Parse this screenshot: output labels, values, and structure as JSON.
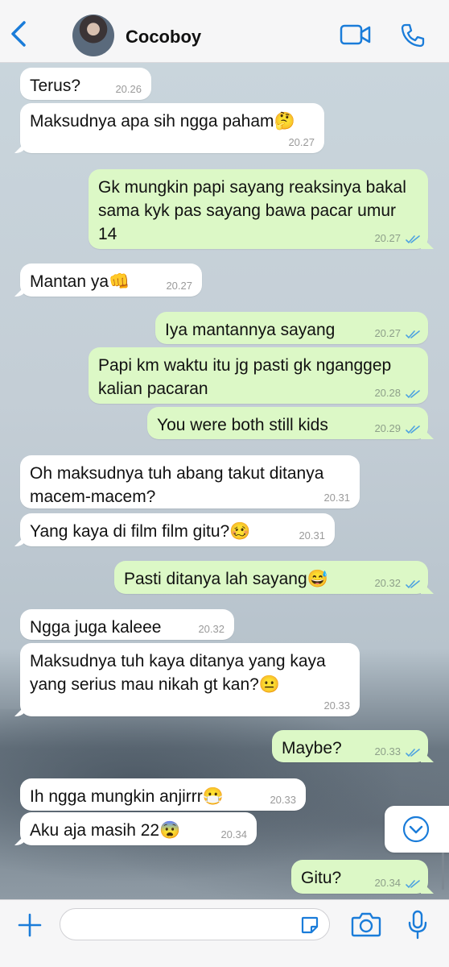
{
  "header": {
    "contact_name": "Cocoboy"
  },
  "messages": [
    {
      "dir": "in",
      "text": "Terus?",
      "time": "20.26"
    },
    {
      "dir": "in",
      "text": "Maksudnya apa sih ngga paham🤔",
      "time": "20.27"
    },
    {
      "dir": "out",
      "text": "Gk mungkin papi sayang reaksinya bakal sama kyk pas sayang bawa pacar umur 14",
      "time": "20.27"
    },
    {
      "dir": "in",
      "text": "Mantan ya👊",
      "time": "20.27"
    },
    {
      "dir": "out",
      "text": "Iya mantannya sayang",
      "time": "20.27"
    },
    {
      "dir": "out",
      "text": "Papi km waktu itu jg pasti gk nganggep kalian pacaran",
      "time": "20.28"
    },
    {
      "dir": "out",
      "text": "You were both still kids",
      "time": "20.29"
    },
    {
      "dir": "in",
      "text": "Oh maksudnya tuh abang takut ditanya macem-macem?",
      "time": "20.31"
    },
    {
      "dir": "in",
      "text": "Yang kaya di film film gitu?🥴",
      "time": "20.31"
    },
    {
      "dir": "out",
      "text": "Pasti ditanya lah sayang😅",
      "time": "20.32"
    },
    {
      "dir": "in",
      "text": "Ngga juga kaleee",
      "time": "20.32"
    },
    {
      "dir": "in",
      "text": "Maksudnya tuh kaya ditanya yang kaya yang serius mau nikah gt kan?😐",
      "time": "20.33"
    },
    {
      "dir": "out",
      "text": "Maybe?",
      "time": "20.33"
    },
    {
      "dir": "in",
      "text": "Ih ngga mungkin anjirrr😷",
      "time": "20.33"
    },
    {
      "dir": "in",
      "text": "Aku aja masih 22😨",
      "time": "20.34"
    },
    {
      "dir": "out",
      "text": "Gitu?",
      "time": "20.34"
    }
  ],
  "footer": {
    "placeholder": ""
  },
  "colors": {
    "accent": "#1a7cd9",
    "outgoing": "#dcf8c6",
    "incoming": "#ffffff"
  },
  "icons": [
    "back-chevron-icon",
    "video-call-icon",
    "phone-icon",
    "plus-icon",
    "sticker-icon",
    "camera-icon",
    "microphone-icon",
    "scroll-down-icon"
  ]
}
